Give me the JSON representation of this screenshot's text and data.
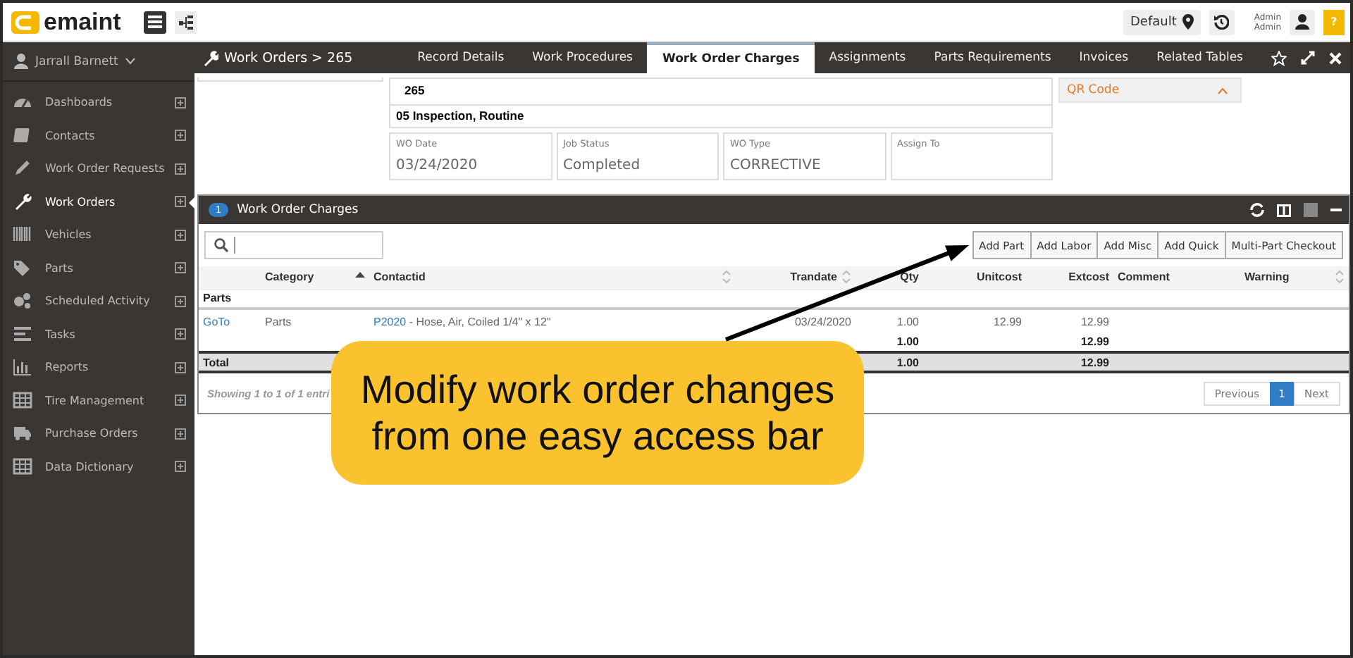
{
  "header": {
    "logo": "emaint",
    "location_button": "Default",
    "user_lines": [
      "Admin",
      "Admin"
    ],
    "help_button": "?"
  },
  "sidebar": {
    "user": "Jarrall Barnett",
    "items": [
      {
        "label": "Dashboards",
        "selected": false
      },
      {
        "label": "Contacts",
        "selected": false
      },
      {
        "label": "Work Order Requests",
        "selected": false
      },
      {
        "label": "Work Orders",
        "selected": true
      },
      {
        "label": "Vehicles",
        "selected": false
      },
      {
        "label": "Parts",
        "selected": false
      },
      {
        "label": "Scheduled Activity",
        "selected": false
      },
      {
        "label": "Tasks",
        "selected": false
      },
      {
        "label": "Reports",
        "selected": false
      },
      {
        "label": "Tire Management",
        "selected": false
      },
      {
        "label": "Purchase Orders",
        "selected": false
      },
      {
        "label": "Data Dictionary",
        "selected": false
      }
    ]
  },
  "breadcrumb": "Work Orders > 265",
  "tabs": [
    {
      "label": "Record Details",
      "selected": false
    },
    {
      "label": "Work Procedures",
      "selected": false
    },
    {
      "label": "Work Order Charges",
      "selected": true
    },
    {
      "label": "Assignments",
      "selected": false
    },
    {
      "label": "Parts Requirements",
      "selected": false
    },
    {
      "label": "Invoices",
      "selected": false
    },
    {
      "label": "Related Tables",
      "selected": false
    }
  ],
  "record": {
    "number": "265",
    "title": "05 Inspection, Routine",
    "fields": [
      {
        "label": "WO Date",
        "value": "03/24/2020"
      },
      {
        "label": "Job Status",
        "value": "Completed"
      },
      {
        "label": "WO Type",
        "value": "CORRECTIVE"
      },
      {
        "label": "Assign To"
      }
    ],
    "qr_section": "QR Code"
  },
  "panel": {
    "count": "1",
    "title": "Work Order Charges",
    "buttons": [
      "Add Part",
      "Add Labor",
      "Add Misc",
      "Add Quick",
      "Multi-Part Checkout"
    ],
    "columns": [
      {
        "label": "Category",
        "sortable": true,
        "sorted": true
      },
      {
        "label": "Contactid",
        "sortable": true,
        "sorted": false
      },
      {
        "label": "Trandate",
        "sortable": true,
        "sorted": false
      },
      {
        "label": "Qty",
        "sortable": false,
        "sorted": false
      },
      {
        "label": "Unitcost",
        "sortable": false,
        "sorted": false
      },
      {
        "label": "Extcost",
        "sortable": false,
        "sorted": false
      },
      {
        "label": "Comment",
        "sortable": false,
        "sorted": false
      },
      {
        "label": "Warning",
        "sortable": true,
        "sorted": false
      }
    ],
    "rows": [
      {
        "kind": "group",
        "label": "Parts"
      },
      {
        "kind": "item",
        "link": "GoTo",
        "category": "Parts",
        "part_id": "P2020",
        "description": " - Hose, Air, Coiled 1/4\" x 12\"",
        "trandate": "03/24/2020",
        "qty": "1.00",
        "unitcost": "12.99",
        "extcost": "12.99"
      },
      {
        "kind": "subtotal",
        "qty": "1.00",
        "extcost": "12.99"
      },
      {
        "kind": "total",
        "label": "Total",
        "qty": "1.00",
        "extcost": "12.99"
      }
    ],
    "info": "Showing 1 to 1 of 1 entri",
    "pages": [
      {
        "label": "Previous",
        "kind": "nav",
        "selected": false
      },
      {
        "label": "1",
        "kind": "page",
        "selected": true
      },
      {
        "label": "Next",
        "kind": "nav",
        "selected": false
      }
    ]
  },
  "callout": {
    "lines": [
      "Modify work order changes",
      "from one easy access bar"
    ]
  }
}
